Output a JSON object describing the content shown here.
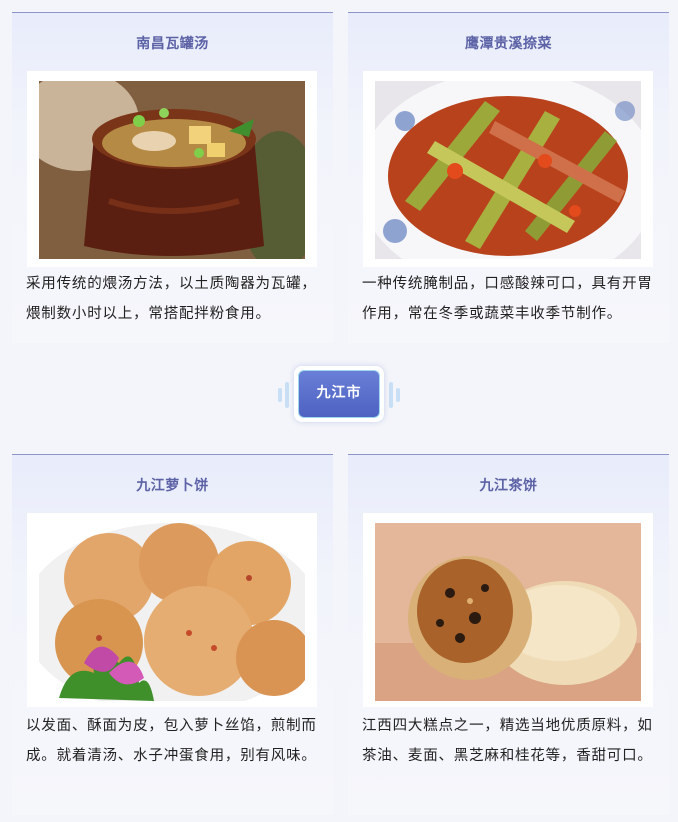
{
  "sections": [
    {
      "cards": [
        {
          "title": "南昌瓦罐汤",
          "description": "采用传统的煨汤方法，以土质陶器为瓦罐，煨制数小时以上，常搭配拌粉食用。",
          "image_subject": "clay-pot-soup"
        },
        {
          "title": "鹰潭贵溪捺菜",
          "description": "一种传统腌制品，口感酸辣可口，具有开胃作用，常在冬季或蔬菜丰收季节制作。",
          "image_subject": "pickled-vegetables"
        }
      ]
    },
    {
      "city": "九江市",
      "cards": [
        {
          "title": "九江萝卜饼",
          "description": "以发面、酥面为皮，包入萝卜丝馅，煎制而成。就着清汤、水子冲蛋食用，别有风味。",
          "image_subject": "radish-pancakes"
        },
        {
          "title": "九江茶饼",
          "description": "江西四大糕点之一，精选当地优质原料，如茶油、麦面、黑芝麻和桂花等，香甜可口。",
          "image_subject": "tea-cakes"
        }
      ]
    }
  ],
  "colors": {
    "title": "#5c62a6",
    "badge": "#5469c8",
    "card_top": "#e8ecfb"
  }
}
